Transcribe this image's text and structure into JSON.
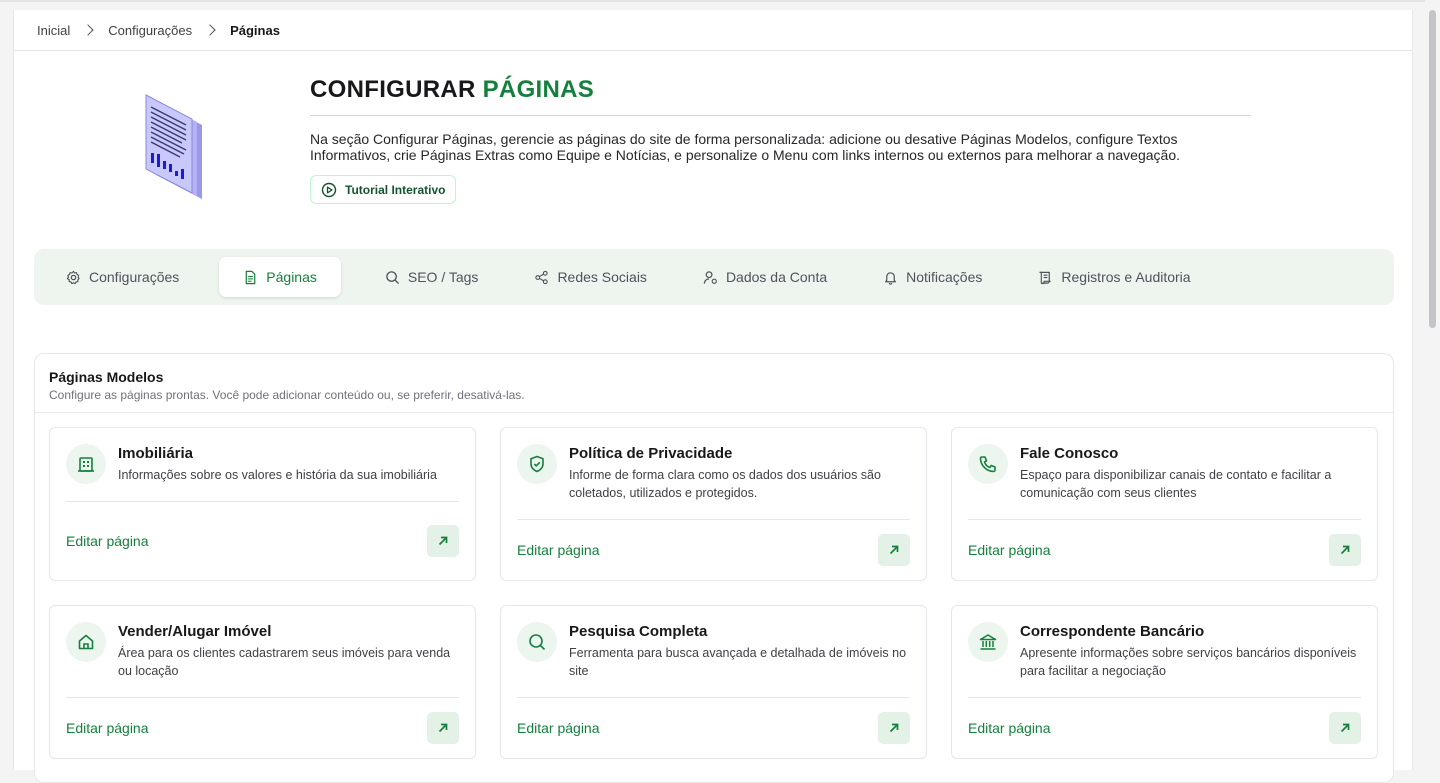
{
  "breadcrumb": {
    "items": [
      "Inicial",
      "Configurações",
      "Páginas"
    ]
  },
  "hero": {
    "title_prefix": "CONFIGURAR",
    "title_accent": "PÁGINAS",
    "description": "Na seção Configurar Páginas, gerencie as páginas do site de forma personalizada: adicione ou desative Páginas Modelos, configure Textos Informativos, crie Páginas Extras como Equipe e Notícias, e personalize o Menu com links internos ou externos para melhorar a navegação.",
    "tutorial_label": "Tutorial Interativo"
  },
  "tabs": [
    {
      "label": "Configurações",
      "icon": "gear-icon",
      "active": false
    },
    {
      "label": "Páginas",
      "icon": "document-icon",
      "active": true
    },
    {
      "label": "SEO / Tags",
      "icon": "search-icon",
      "active": false
    },
    {
      "label": "Redes Sociais",
      "icon": "share-icon",
      "active": false
    },
    {
      "label": "Dados da Conta",
      "icon": "user-icon",
      "active": false
    },
    {
      "label": "Notificações",
      "icon": "bell-icon",
      "active": false
    },
    {
      "label": "Registros e Auditoria",
      "icon": "scroll-icon",
      "active": false
    }
  ],
  "section": {
    "title": "Páginas Modelos",
    "subtitle": "Configure as páginas prontas. Você pode adicionar conteúdo ou, se preferir, desativá-las."
  },
  "cards": [
    {
      "title": "Imobiliária",
      "description": "Informações sobre os valores e história da sua imobiliária",
      "icon": "building-icon",
      "link": "Editar página"
    },
    {
      "title": "Política de Privacidade",
      "description": "Informe de forma clara como os dados dos usuários são coletados, utilizados e protegidos.",
      "icon": "shield-icon",
      "link": "Editar página"
    },
    {
      "title": "Fale Conosco",
      "description": "Espaço para disponibilizar canais de contato e facilitar a comunicação com seus clientes",
      "icon": "phone-icon",
      "link": "Editar página"
    },
    {
      "title": "Vender/Alugar Imóvel",
      "description": "Área para os clientes cadastrarem seus imóveis para venda ou locação",
      "icon": "home-icon",
      "link": "Editar página"
    },
    {
      "title": "Pesquisa Completa",
      "description": "Ferramenta para busca avançada e detalhada de imóveis no site",
      "icon": "search-icon",
      "link": "Editar página"
    },
    {
      "title": "Correspondente Bancário",
      "description": "Apresente informações sobre serviços bancários disponíveis para facilitar a negociação",
      "icon": "bank-icon",
      "link": "Editar página"
    }
  ],
  "colors": {
    "accent": "#15803d",
    "tab_bar": "#edf5ee",
    "icon_bg": "#ecf5ee"
  }
}
